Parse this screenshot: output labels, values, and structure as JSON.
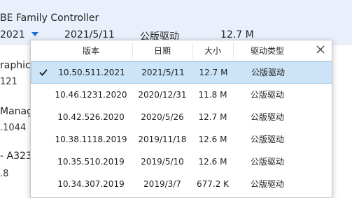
{
  "background": {
    "device_title": "BE Family Controller",
    "selected_row": {
      "version_partial": "2021",
      "date": "2021/5/11",
      "type": "公版驱动",
      "size": "12.7 M"
    },
    "left_items": [
      {
        "name": "raphics",
        "sub": "121"
      },
      {
        "name": "Manage",
        "sub": ".1044"
      },
      {
        "name": "- A323",
        "sub": ".8"
      }
    ]
  },
  "popup": {
    "columns": [
      "版本",
      "日期",
      "大小",
      "驱动类型"
    ],
    "close_label": "×",
    "rows": [
      {
        "version": "10.50.511.2021",
        "date": "2021/5/11",
        "size": "12.7 M",
        "type": "公版驱动",
        "selected": true
      },
      {
        "version": "10.46.1231.2020",
        "date": "2020/12/31",
        "size": "11.8 M",
        "type": "公版驱动",
        "selected": false
      },
      {
        "version": "10.42.526.2020",
        "date": "2020/5/26",
        "size": "12.7 M",
        "type": "公版驱动",
        "selected": false
      },
      {
        "version": "10.38.1118.2019",
        "date": "2019/11/18",
        "size": "12.6 M",
        "type": "公版驱动",
        "selected": false
      },
      {
        "version": "10.35.510.2019",
        "date": "2019/5/10",
        "size": "12.6 M",
        "type": "公版驱动",
        "selected": false
      },
      {
        "version": "10.34.307.2019",
        "date": "2019/3/7",
        "size": "677.2 K",
        "type": "公版驱动",
        "selected": false
      }
    ]
  },
  "colors": {
    "accent": "#1c6dd0",
    "selected_bg": "#cce4f7",
    "header_bg": "#e9f0fb"
  },
  "icons": {
    "dropdown": "caret-down-icon",
    "selected": "checkmark-icon",
    "close": "close-icon"
  }
}
